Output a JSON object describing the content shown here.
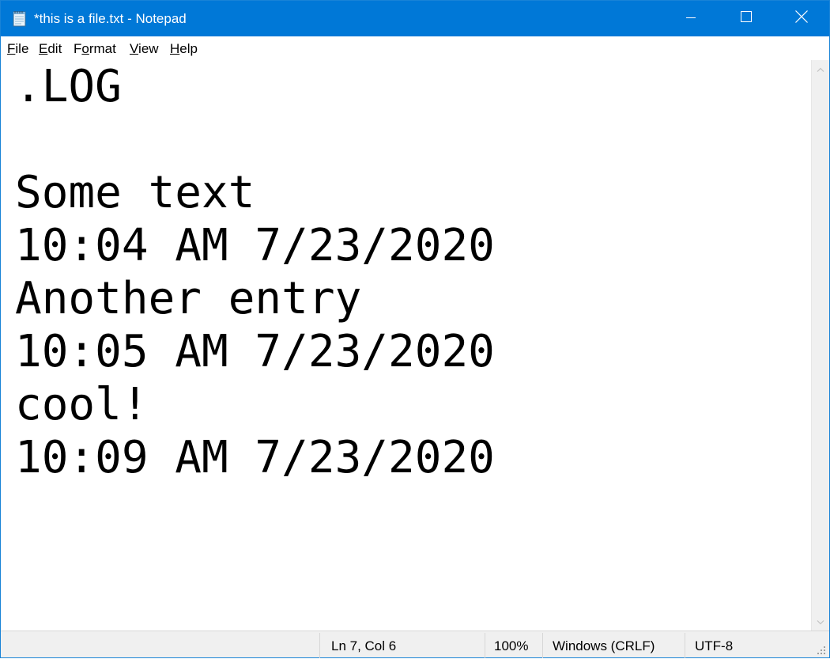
{
  "window": {
    "title": "*this is a file.txt - Notepad",
    "accent_color": "#0078d7"
  },
  "titlebar": {
    "app_icon": "notepad-icon",
    "minimize_icon": "minimize-icon",
    "maximize_icon": "maximize-icon",
    "close_icon": "close-icon"
  },
  "menu": {
    "items": [
      {
        "label": "File",
        "access_key": "F"
      },
      {
        "label": "Edit",
        "access_key": "E"
      },
      {
        "label": "Format",
        "access_key": "o"
      },
      {
        "label": "View",
        "access_key": "V"
      },
      {
        "label": "Help",
        "access_key": "H"
      }
    ]
  },
  "editor": {
    "lines": [
      ".LOG",
      "",
      "Some text",
      "10:04 AM 7/23/2020",
      "Another entry",
      "10:05 AM 7/23/2020",
      "cool!",
      "10:09 AM 7/23/2020"
    ]
  },
  "status": {
    "position": "Ln 7, Col 6",
    "zoom": "100%",
    "line_ending": "Windows (CRLF)",
    "encoding": "UTF-8"
  }
}
